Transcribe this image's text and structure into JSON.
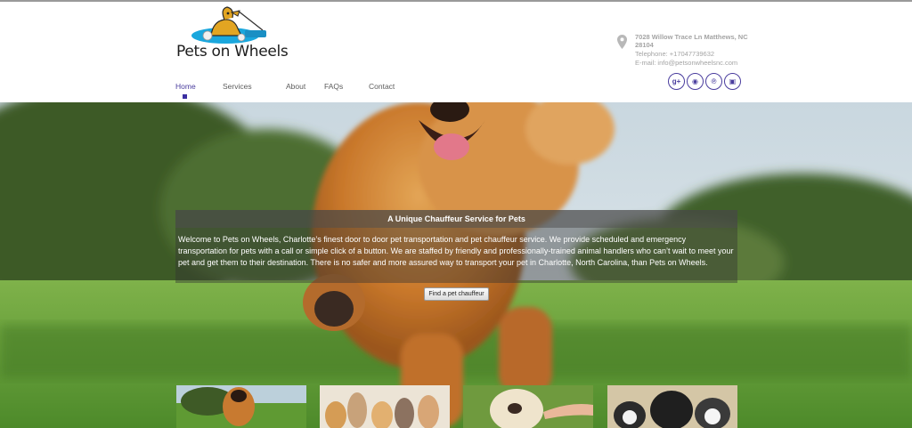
{
  "header": {
    "logo_text": "Pets on Wheels",
    "address": "7028 Willow Trace Ln Matthews, NC 28104",
    "telephone": "Telephone: +17047739632",
    "email": "E-mail: info@petsonwheelsnc.com"
  },
  "nav": {
    "items": [
      {
        "label": "Home",
        "active": true
      },
      {
        "label": "Services"
      },
      {
        "label": "About"
      },
      {
        "label": "FAQs"
      },
      {
        "label": "Contact"
      }
    ]
  },
  "social": [
    {
      "icon": "google-plus-icon",
      "glyph": "g+"
    },
    {
      "icon": "rss-icon",
      "glyph": "◉"
    },
    {
      "icon": "pinterest-icon",
      "glyph": "℗"
    },
    {
      "icon": "instagram-icon",
      "glyph": "▣"
    }
  ],
  "hero": {
    "title": "A Unique Chauffeur Service for Pets",
    "body": "Welcome to Pets on Wheels, Charlotte’s finest door to door pet transportation and pet chauffeur service. We provide scheduled and emergency transportation for pets with a call or simple click of a button. We are staffed by friendly and professionally-trained animal handlers who can’t wait to meet your pet and get them to their destination. There is no safer and more assured way to transport your pet in Charlotte, North Carolina, than Pets on Wheels.",
    "cta_label": "Find a pet chauffeur"
  },
  "colors": {
    "accent": "#4a3d9e",
    "nav_text": "#5d5d5d",
    "contact_text": "#a4a4a4"
  },
  "thumbnails": [
    {
      "name": "running-dog-thumbnail"
    },
    {
      "name": "cats-and-dogs-thumbnail"
    },
    {
      "name": "dog-petting-thumbnail"
    },
    {
      "name": "bulldogs-thumbnail"
    }
  ]
}
